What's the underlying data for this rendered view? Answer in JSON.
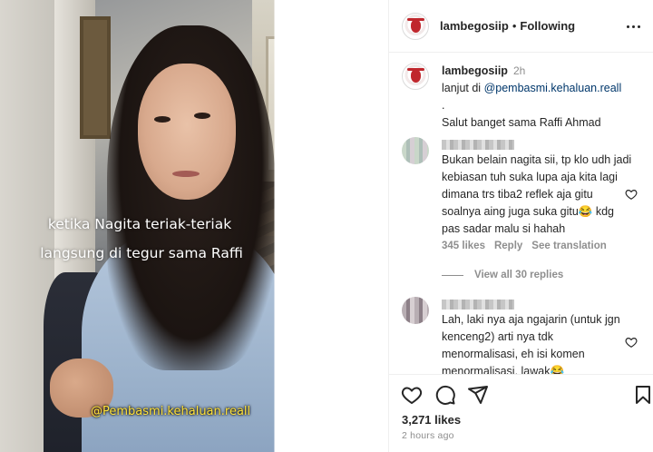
{
  "media": {
    "caption_line1": "ketika Nagita teriak-teriak",
    "caption_line2": "langsung di tegur sama Raffi",
    "watermark": "@Pembasmi.kehaluan.reall"
  },
  "header": {
    "username": "lambegosiip",
    "separator": "•",
    "follow_status": "Following",
    "more_icon": "more-horizontal-icon"
  },
  "caption": {
    "username": "lambegosiip",
    "time": "2h",
    "text_prefix": "lanjut di ",
    "mention": "@pembasmi.kehaluan.reall",
    "dot_line": ".",
    "text_line3": "Salut banget sama Raffi Ahmad"
  },
  "comments": [
    {
      "text": "Bukan belain nagita sii, tp klo udh jadi kebiasan tuh suka lupa aja kita lagi dimana trs tiba2 reflek aja gitu soalnya aing juga suka gitu😂 kdg pas sadar malu si hahah",
      "likes": "345 likes",
      "reply": "Reply",
      "translate": "See translation",
      "view_replies": "View all 30 replies"
    },
    {
      "text": "Lah, laki nya aja ngajarin (untuk jgn kenceng2) arti nya tdk menormalisasi, eh isi komen menormalisasi, lawak😂"
    }
  ],
  "actions": {
    "likes": "3,271 likes",
    "time_ago": "2 hours ago",
    "icons": [
      "heart-icon",
      "comment-icon",
      "share-icon",
      "bookmark-icon"
    ]
  },
  "colors": {
    "text": "#262626",
    "muted": "#8e8e8e",
    "mention": "#00376b",
    "border": "#efefef",
    "watermark": "#ffe23a"
  }
}
